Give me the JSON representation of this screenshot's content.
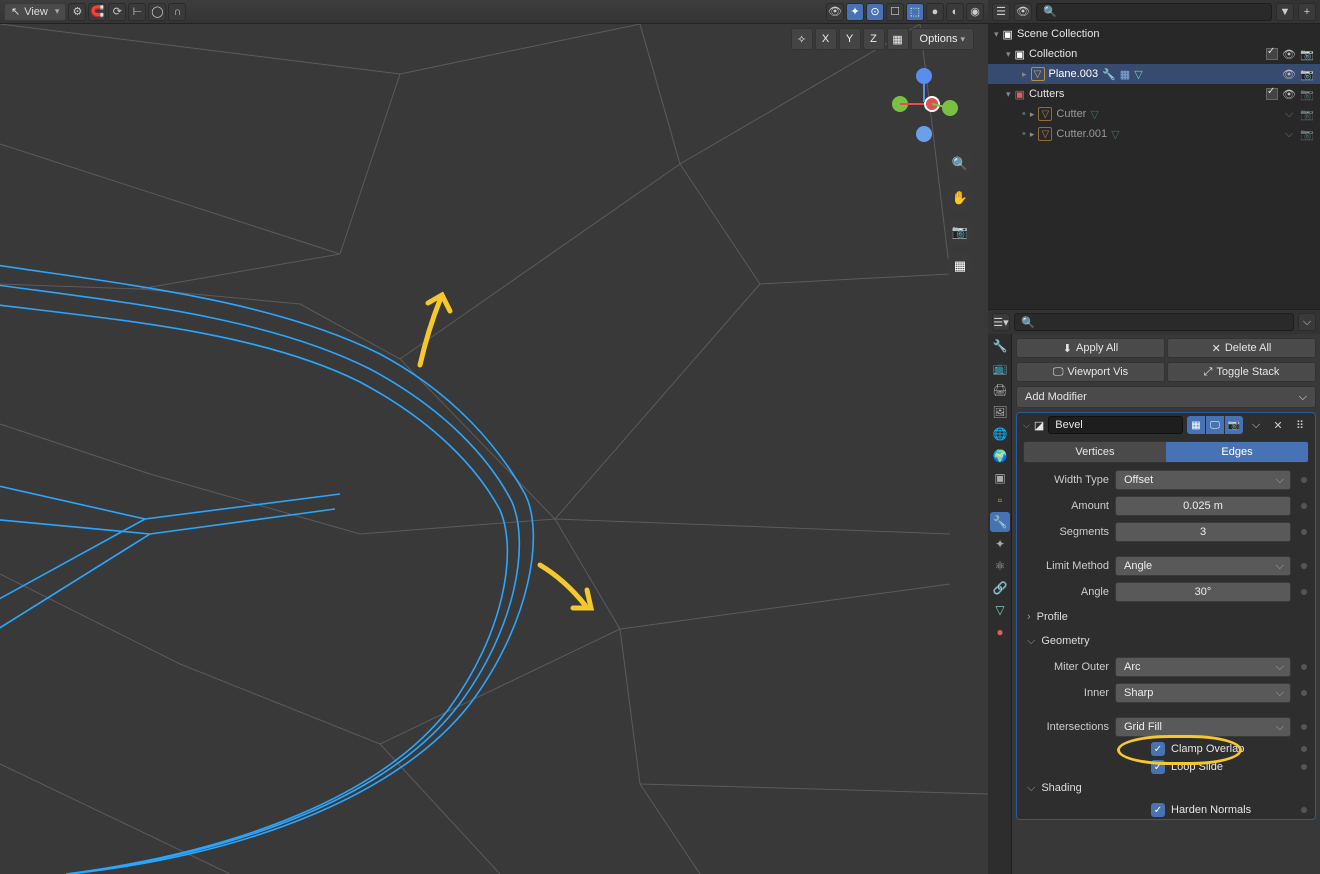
{
  "viewport_header": {
    "view_menu": "View",
    "options_menu": "Options",
    "xyz": [
      "X",
      "Y",
      "Z"
    ]
  },
  "search_placeholder": "",
  "outliner": {
    "root": "Scene Collection",
    "collection": "Collection",
    "active_object": "Plane.003",
    "cutters_collection": "Cutters",
    "cutter1": "Cutter",
    "cutter2": "Cutter.001"
  },
  "modifier_buttons": {
    "apply_all": "Apply All",
    "delete_all": "Delete All",
    "viewport_vis": "Viewport Vis",
    "toggle_stack": "Toggle Stack",
    "add_modifier": "Add Modifier"
  },
  "bevel": {
    "name": "Bevel",
    "tab_vertices": "Vertices",
    "tab_edges": "Edges",
    "width_type_label": "Width Type",
    "width_type_value": "Offset",
    "amount_label": "Amount",
    "amount_value": "0.025 m",
    "segments_label": "Segments",
    "segments_value": "3",
    "limit_method_label": "Limit Method",
    "limit_method_value": "Angle",
    "angle_label": "Angle",
    "angle_value": "30°",
    "profile_section": "Profile",
    "geometry_section": "Geometry",
    "miter_outer_label": "Miter Outer",
    "miter_outer_value": "Arc",
    "inner_label": "Inner",
    "inner_value": "Sharp",
    "intersections_label": "Intersections",
    "intersections_value": "Grid Fill",
    "clamp_overlap": "Clamp Overlap",
    "loop_slide": "Loop Slide",
    "shading_section": "Shading",
    "harden_normals": "Harden Normals"
  },
  "chart_data": {
    "type": "table",
    "title": "Bevel Modifier Settings",
    "series": [
      {
        "name": "Width Type",
        "values": [
          "Offset"
        ]
      },
      {
        "name": "Amount",
        "values": [
          0.025
        ]
      },
      {
        "name": "Segments",
        "values": [
          3
        ]
      },
      {
        "name": "Limit Method",
        "values": [
          "Angle"
        ]
      },
      {
        "name": "Angle",
        "values": [
          30
        ]
      },
      {
        "name": "Miter Outer",
        "values": [
          "Arc"
        ]
      },
      {
        "name": "Inner",
        "values": [
          "Sharp"
        ]
      },
      {
        "name": "Intersections",
        "values": [
          "Grid Fill"
        ]
      },
      {
        "name": "Clamp Overlap",
        "values": [
          true
        ]
      },
      {
        "name": "Loop Slide",
        "values": [
          true
        ]
      },
      {
        "name": "Harden Normals",
        "values": [
          true
        ]
      }
    ]
  }
}
